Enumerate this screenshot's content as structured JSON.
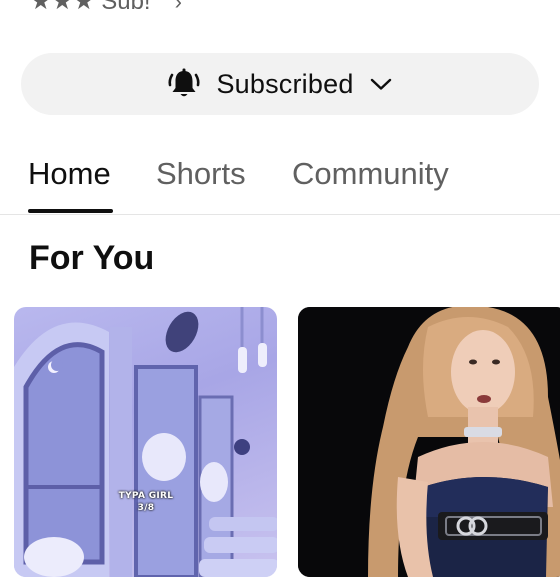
{
  "channel": {
    "top_text": "★★★ Sub!",
    "top_chevron": "›"
  },
  "subscribe": {
    "label": "Subscribed",
    "icon": "bell-icon",
    "dropdown_icon": "chevron-down-icon"
  },
  "tabs": [
    {
      "label": "Home",
      "active": true
    },
    {
      "label": "Shorts",
      "active": false
    },
    {
      "label": "Community",
      "active": false
    }
  ],
  "section": {
    "title": "For You"
  },
  "shorts": [
    {
      "caption_line1": "TYPA GIRL",
      "caption_line2": "3/8"
    },
    {}
  ],
  "colors": {
    "pill_bg": "#f2f2f2",
    "active_text": "#0f0f0f",
    "inactive_text": "#606060",
    "divider": "#e5e5e5"
  }
}
